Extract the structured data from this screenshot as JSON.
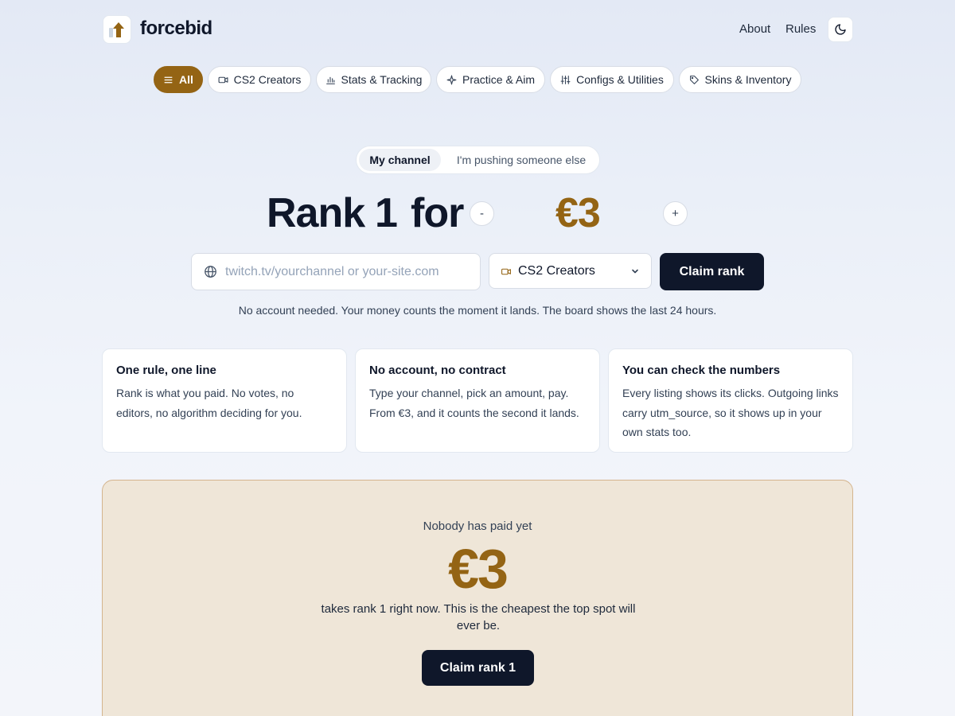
{
  "header": {
    "brand": "forcebid",
    "logo_icon": "arrow-up-bars-logo",
    "nav": [
      "About",
      "Rules"
    ],
    "theme_toggle_icon": "moon-icon"
  },
  "categories": [
    {
      "label": "All",
      "icon": "list-icon",
      "active": true
    },
    {
      "label": "CS2 Creators",
      "icon": "video-camera-icon",
      "active": false
    },
    {
      "label": "Stats & Tracking",
      "icon": "bar-chart-icon",
      "active": false
    },
    {
      "label": "Practice & Aim",
      "icon": "sparkle-icon",
      "active": false
    },
    {
      "label": "Configs & Utilities",
      "icon": "sliders-icon",
      "active": false
    },
    {
      "label": "Skins & Inventory",
      "icon": "tag-icon",
      "active": false
    }
  ],
  "mode_toggle": {
    "options": [
      "My channel",
      "I'm pushing someone else"
    ],
    "selected": "My channel"
  },
  "rank_line": {
    "word_rank": "Rank",
    "rank_number": "1",
    "word_for": "for",
    "decrement": "-",
    "increment": "+",
    "price": "€3"
  },
  "form": {
    "url_placeholder": "twitch.tv/yourchannel or your-site.com",
    "url_value": "",
    "category_selected": "CS2 Creators",
    "submit_label": "Claim rank"
  },
  "note": "No account needed. Your money counts the moment it lands. The board shows the last 24 hours.",
  "cards": [
    {
      "title": "One rule, one line",
      "body": "Rank is what you paid. No votes, no editors, no algorithm deciding for you."
    },
    {
      "title": "No account, no contract",
      "body": "Type your channel, pick an amount, pay. From €3, and it counts the second it lands."
    },
    {
      "title": "You can check the numbers",
      "body": "Every listing shows its clicks. Outgoing links carry utm_source, so it shows up in your own stats too."
    }
  ],
  "empty_board": {
    "title": "Nobody has paid yet",
    "price": "€3",
    "subtitle": "takes rank 1 right now. This is the cheapest the top spot will ever be.",
    "button": "Claim rank 1"
  },
  "colors": {
    "accent": "#946414",
    "dark": "#0f172a",
    "panel_bg": "#efe6d8",
    "panel_border": "#d4b48d"
  }
}
